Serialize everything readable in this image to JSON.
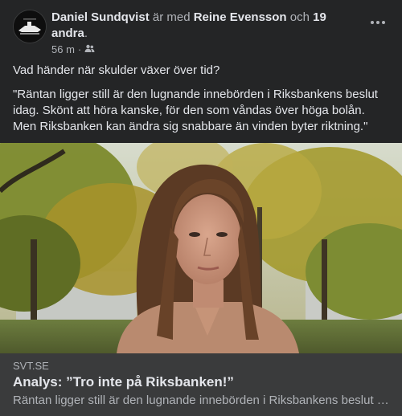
{
  "post": {
    "author": "Daniel Sundqvist",
    "with_text": "är med",
    "tagged_person": "Reine Evensson",
    "and_text": "och",
    "others": "19 andra",
    "period": ".",
    "time": "56 m",
    "separator": "·",
    "audience_icon": "friends-icon",
    "more_icon": "more-horizontal-icon",
    "text_line1": "Vad händer när skulder växer över tid?",
    "text_quote": "\"Räntan ligger still är den lugnande innebörden i Riksbankens beslut idag. Skönt att höra kanske, för den som våndas över höga bolån. Men Riksbanken kan ändra sig snabbare än vinden byter riktning.\""
  },
  "link_preview": {
    "source": "SVT.SE",
    "title": "Analys: ”Tro inte på Riksbanken!”",
    "description": "Räntan ligger still är den lugnande innebörden i Riksbankens beslut idag. Skönt att höra kanske, för den som våndas över höga bolån."
  },
  "colors": {
    "background": "#242526",
    "link_box": "#3a3b3c",
    "primary_text": "#e4e6eb",
    "secondary_text": "#b0b3b8"
  }
}
